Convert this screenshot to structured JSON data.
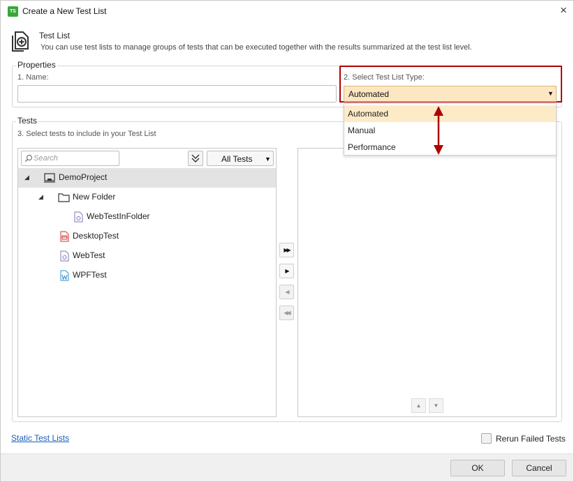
{
  "window": {
    "title": "Create a New Test List",
    "app_logo": "TS",
    "close_icon": "×"
  },
  "header": {
    "title": "Test List",
    "description": "You can use test lists to manage groups of tests that can be executed together with the results summarized at the test list level."
  },
  "properties": {
    "legend": "Properties",
    "name_label": "1. Name:",
    "name_value": "",
    "type_label": "2.  Select Test List Type:",
    "type_selected": "Automated",
    "type_options": [
      "Automated",
      "Manual",
      "Performance"
    ]
  },
  "tests": {
    "legend": "Tests",
    "instruction": "3.  Select tests to include in your Test List",
    "search_placeholder": "Search",
    "filter_value": "All Tests",
    "tree": [
      {
        "label": "DemoProject",
        "icon": "project-icon"
      },
      {
        "label": "New Folder",
        "icon": "folder-icon"
      },
      {
        "label": "WebTestInFolder",
        "icon": "web-test-icon"
      },
      {
        "label": "DesktopTest",
        "icon": "desktop-test-icon"
      },
      {
        "label": "WebTest",
        "icon": "web-test-icon"
      },
      {
        "label": "WPFTest",
        "icon": "wpf-test-icon"
      }
    ]
  },
  "footer": {
    "static_link": "Static Test Lists",
    "rerun_label": "Rerun Failed Tests",
    "rerun_checked": false,
    "ok_label": "OK",
    "cancel_label": "Cancel"
  },
  "colors": {
    "accent_highlight": "#b00000",
    "selection": "#fdebc8",
    "link": "#1a5fb4",
    "logo": "#3aa63a"
  }
}
